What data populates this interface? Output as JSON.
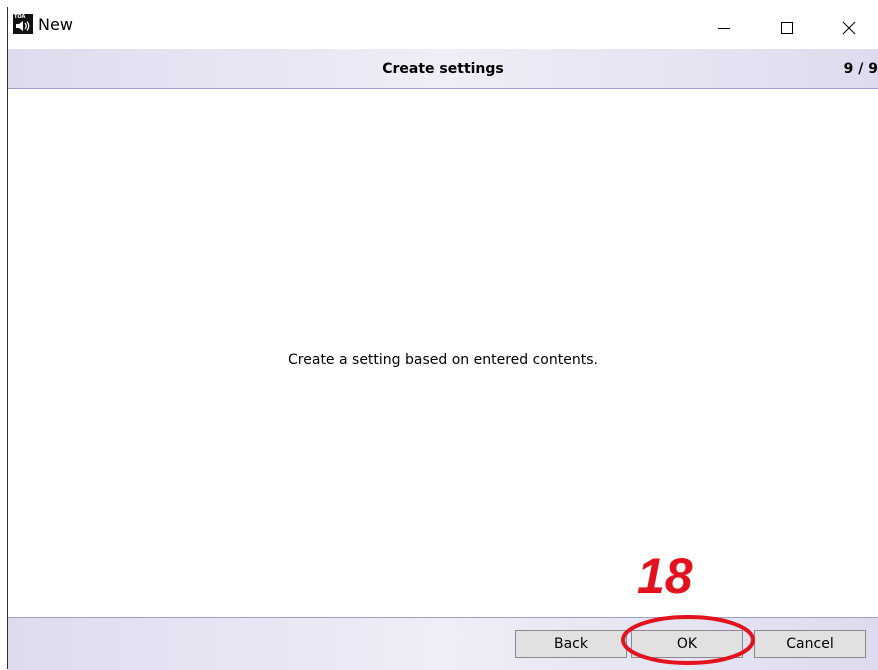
{
  "window": {
    "title": "New",
    "icon": "toa-speaker-app-icon",
    "icon_brand_text": "TOA",
    "controls": {
      "minimize_icon": "minimize-icon",
      "maximize_icon": "maximize-icon",
      "close_icon": "close-icon"
    }
  },
  "header": {
    "title": "Create settings",
    "step": "9 / 9"
  },
  "content": {
    "message": "Create a setting based on entered contents."
  },
  "footer": {
    "back_label": "Back",
    "ok_label": "OK",
    "cancel_label": "Cancel"
  },
  "annotation": {
    "step_number": "18",
    "color": "#e4121f"
  },
  "colors": {
    "band_gradient_edge": "#dcdcee",
    "band_gradient_center": "#eeeef8",
    "band_border": "#9f9fc8",
    "button_bg": "#e1e1e1"
  }
}
